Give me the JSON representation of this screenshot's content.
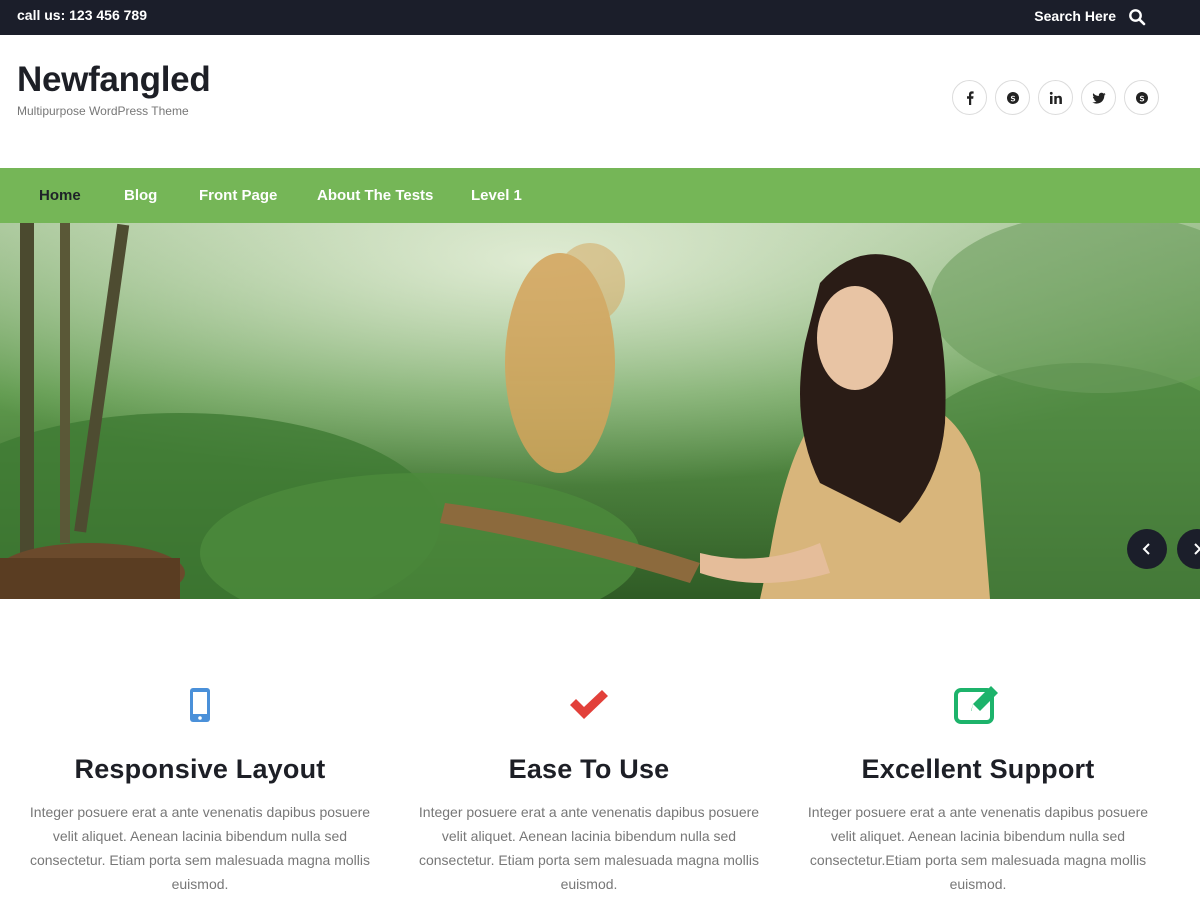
{
  "topbar": {
    "call_text": "call us: 123 456 789",
    "search_text": "Search Here"
  },
  "header": {
    "site_title": "Newfangled",
    "tagline": "Multipurpose WordPress Theme",
    "social": [
      {
        "icon": "facebook-icon",
        "glyph": "f"
      },
      {
        "icon": "skype-icon",
        "glyph": "s"
      },
      {
        "icon": "linkedin-icon",
        "glyph": "in"
      },
      {
        "icon": "twitter-icon",
        "glyph": "t"
      },
      {
        "icon": "skype-icon",
        "glyph": "s"
      }
    ]
  },
  "nav": {
    "items": [
      {
        "label": "Home",
        "active": true
      },
      {
        "label": "Blog"
      },
      {
        "label": "Front Page"
      },
      {
        "label": "About The Tests"
      },
      {
        "label": "Level 1"
      }
    ]
  },
  "hero": {
    "image": "woman-winnowing-rice-photo",
    "prev_icon": "chevron-left-icon",
    "next_icon": "chevron-right-icon"
  },
  "features": [
    {
      "icon": "mobile-phone-icon",
      "icon_color": "#4a90d9",
      "title": "Responsive Layout",
      "text": "Integer posuere erat a ante venenatis dapibus posuere velit aliquet. Aenean lacinia bibendum nulla sed consectetur. Etiam porta sem malesuada magna mollis euismod."
    },
    {
      "icon": "checkmark-icon",
      "icon_color": "#e2403a",
      "title": "Ease To Use",
      "text": "Integer posuere erat a ante venenatis dapibus posuere velit aliquet. Aenean lacinia bibendum nulla sed consectetur. Etiam porta sem malesuada magna mollis euismod."
    },
    {
      "icon": "edit-icon",
      "icon_color": "#1db36b",
      "title": "Excellent Support",
      "text": "Integer posuere erat a ante venenatis dapibus posuere velit aliquet. Aenean lacinia bibendum nulla sed consectetur.Etiam porta sem malesuada magna mollis euismod."
    }
  ],
  "colors": {
    "topbar_bg": "#1b1e2a",
    "nav_bg": "#75b657",
    "nav_active_text": "#1e2228"
  }
}
